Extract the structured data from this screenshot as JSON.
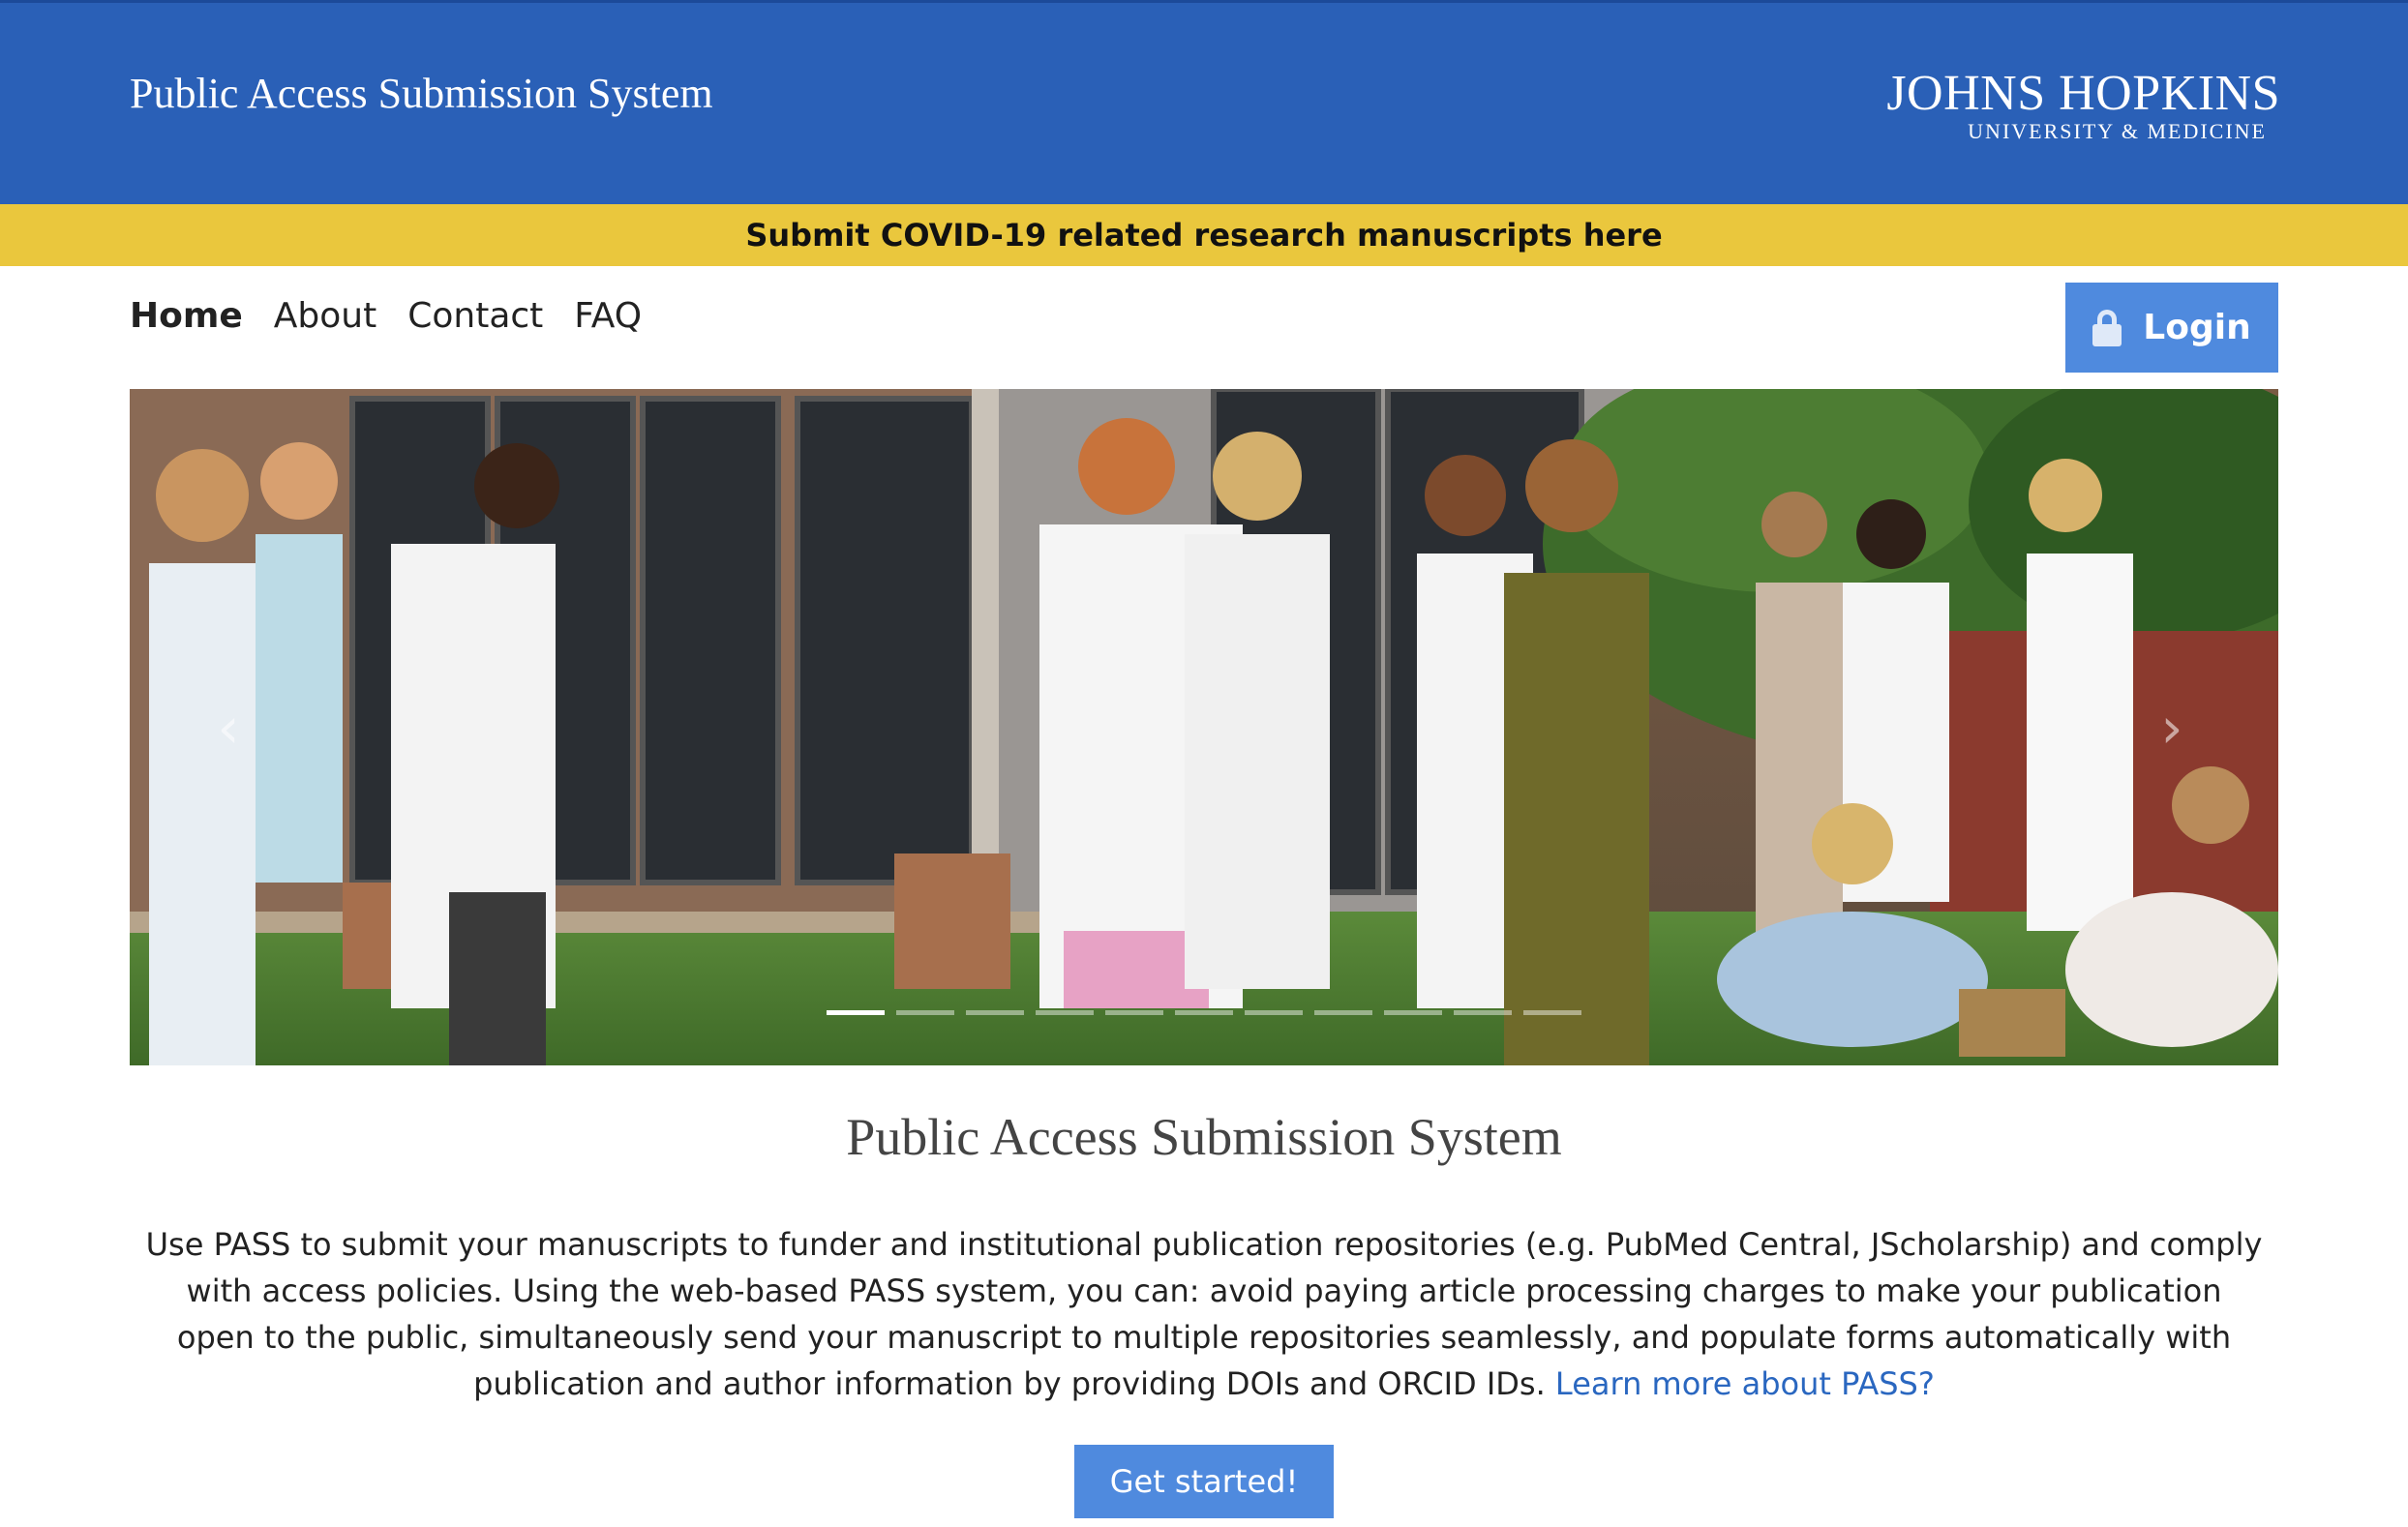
{
  "header": {
    "site_title": "Public Access Submission System",
    "logo_line1": "JOHNS HOPKINS",
    "logo_line2": "UNIVERSITY & MEDICINE",
    "background_color": "#2a60b7"
  },
  "banner": {
    "text": "Submit COVID-19 related research manuscripts here",
    "background_color": "#eac73d"
  },
  "nav": {
    "items": [
      {
        "label": "Home",
        "active": true
      },
      {
        "label": "About",
        "active": false
      },
      {
        "label": "Contact",
        "active": false
      },
      {
        "label": "FAQ",
        "active": false
      }
    ]
  },
  "login": {
    "label": "Login",
    "icon": "lock-icon"
  },
  "carousel": {
    "prev_icon": "chevron-left-icon",
    "next_icon": "chevron-right-icon",
    "slide_count": 11,
    "active_slide": 1
  },
  "main": {
    "title": "Public Access Submission System",
    "intro_text": "Use PASS to submit your manuscripts to funder and institutional publication repositories (e.g. PubMed Central, JScholarship) and comply with access policies. Using the web-based PASS system, you can: avoid paying article processing charges to make your publication open to the public, simultaneously send your manuscript to multiple repositories seamlessly, and populate forms automatically with publication and author information by providing DOIs and ORCID IDs.",
    "learn_more": "Learn more about PASS?",
    "cta_label": "Get started!",
    "accent_color": "#4f8ade"
  }
}
